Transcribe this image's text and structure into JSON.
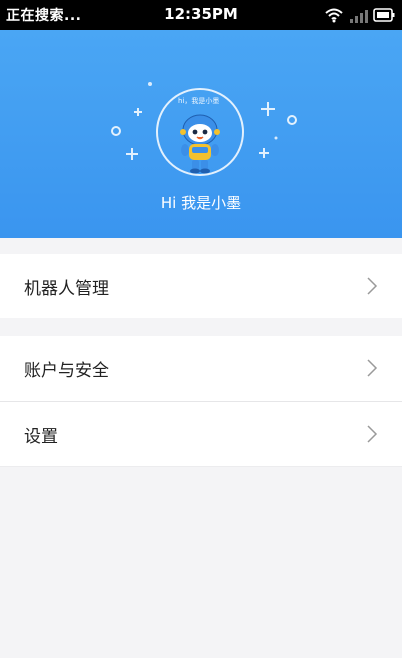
{
  "status_bar": {
    "left_text": "正在搜索...",
    "time": "12:35PM"
  },
  "hero": {
    "avatar_caption": "hi，我是小墨",
    "greeting": "Hi 我是小墨"
  },
  "menu": {
    "group1": [
      {
        "label": "机器人管理"
      }
    ],
    "group2": [
      {
        "label": "账户与安全"
      },
      {
        "label": "设置"
      }
    ]
  },
  "colors": {
    "hero_top": "#4aa6f4",
    "hero_bottom": "#3a95ef",
    "background": "#f4f4f6"
  }
}
